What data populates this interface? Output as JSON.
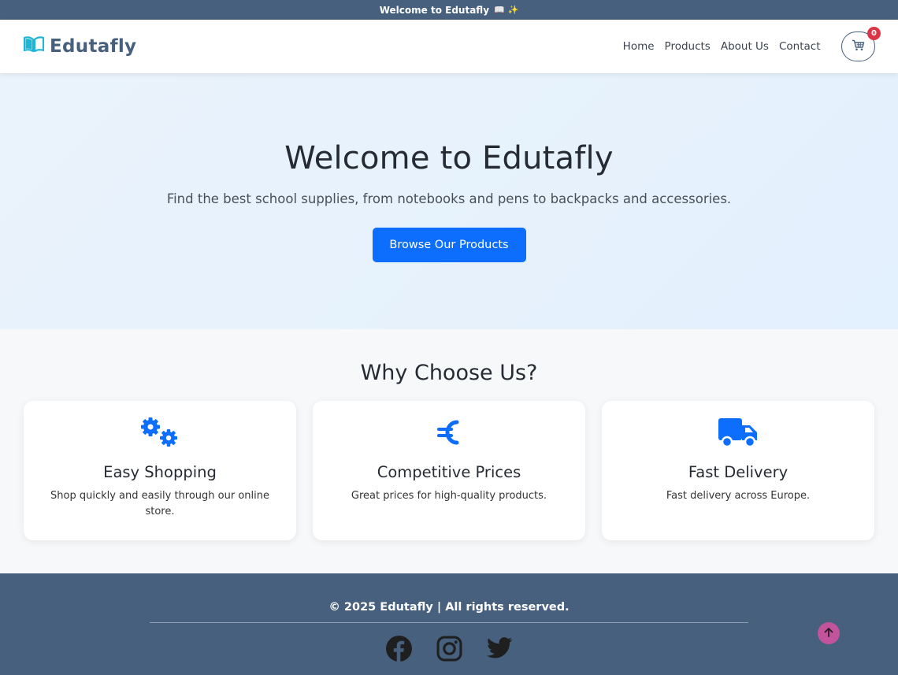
{
  "announcement": {
    "text": "Welcome to Edutafly",
    "emoji": "📖 ✨"
  },
  "navbar": {
    "brand": "Edutafly",
    "links": [
      "Home",
      "Products",
      "About Us",
      "Contact"
    ],
    "cart_count": "0"
  },
  "hero": {
    "title": "Welcome to Edutafly",
    "subtitle": "Find the best school supplies, from notebooks and pens to backpacks and accessories.",
    "cta": "Browse Our Products"
  },
  "why": {
    "title": "Why Choose Us?",
    "cards": [
      {
        "icon": "gears-icon",
        "title": "Easy Shopping",
        "text": "Shop quickly and easily through our online store."
      },
      {
        "icon": "euro-icon",
        "title": "Competitive Prices",
        "text": "Great prices for high-quality products."
      },
      {
        "icon": "truck-icon",
        "title": "Fast Delivery",
        "text": "Fast delivery across Europe."
      }
    ]
  },
  "footer": {
    "copyright": "© 2025 Edutafly | All rights reserved.",
    "socials": [
      "facebook-icon",
      "instagram-icon",
      "twitter-icon"
    ]
  },
  "colors": {
    "primary": "#0d6efd",
    "navy": "#46607d",
    "badge": "#dc3545",
    "brand_icon": "#1fb6d6",
    "to_top": "#c1549b"
  }
}
